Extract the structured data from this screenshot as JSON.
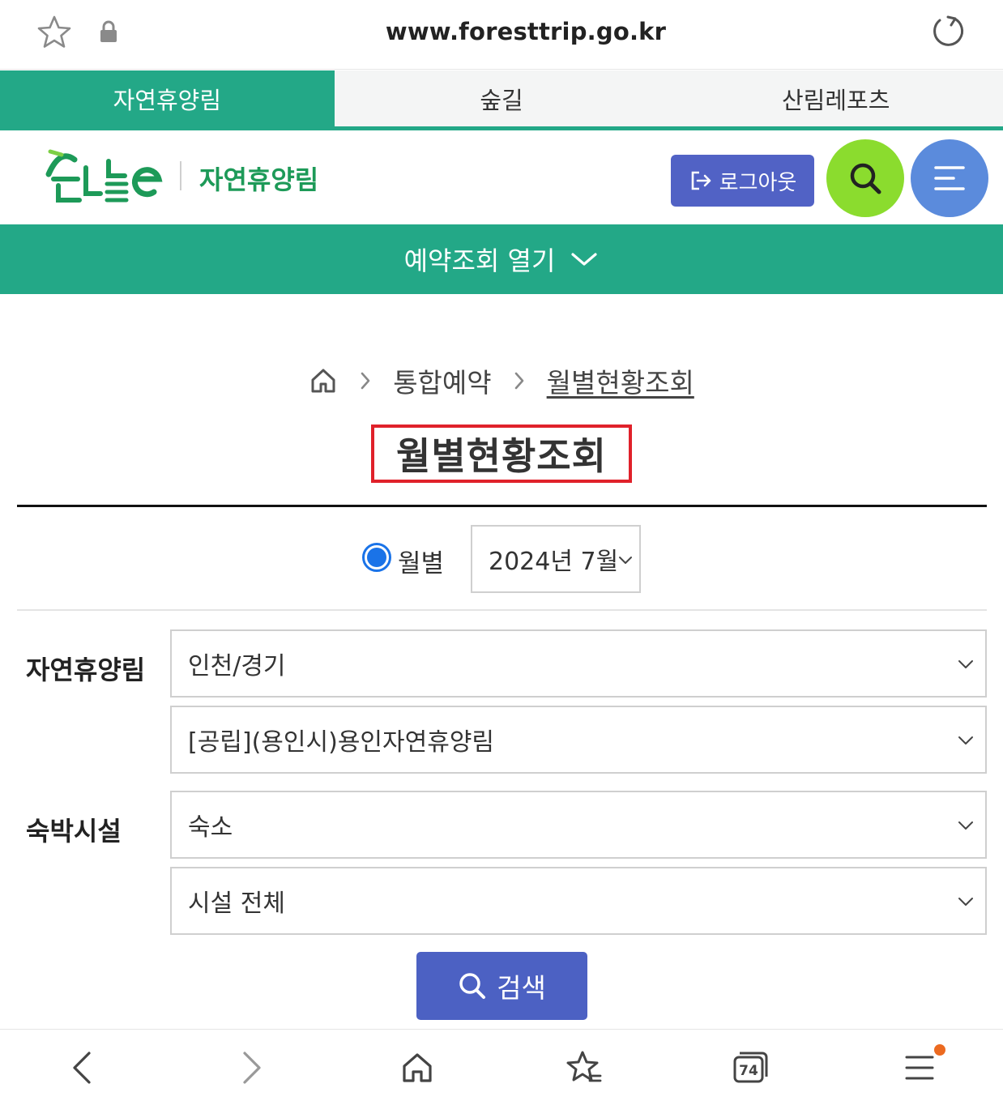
{
  "browser": {
    "url": "www.foresttrip.go.kr",
    "tab_count": "74"
  },
  "category_tabs": [
    {
      "label": "자연휴양림",
      "active": true
    },
    {
      "label": "숲길",
      "active": false
    },
    {
      "label": "산림레포츠",
      "active": false
    }
  ],
  "header": {
    "site_name": "자연휴양림",
    "logout_label": "로그아웃"
  },
  "reservation_bar": {
    "label": "예약조회 열기"
  },
  "breadcrumb": {
    "items": [
      "통합예약",
      "월별현황조회"
    ]
  },
  "page": {
    "title": "월별현황조회"
  },
  "month_filter": {
    "radio_label": "월별",
    "selected_month": "2024년 7월"
  },
  "form": {
    "forest_label": "자연휴양림",
    "region_value": "인천/경기",
    "forest_value": "[공립](용인시)용인자연휴양림",
    "facility_label": "숙박시설",
    "facility_type_value": "숙소",
    "facility_value": "시설 전체",
    "search_label": "검색"
  },
  "colors": {
    "brand_green": "#23a887",
    "logout_blue": "#5162c5",
    "search_green": "#8bdc2e",
    "menu_blue": "#5b8bdc",
    "highlight_red": "#e0212a",
    "search_button": "#4c61c3"
  },
  "icons": {
    "address_bar": [
      "bookmark-star-icon",
      "lock-icon",
      "reload-icon"
    ],
    "header": [
      "logo-icon",
      "logout-icon",
      "search-icon",
      "menu-icon"
    ],
    "bottom_nav": [
      "back-icon",
      "forward-icon",
      "home-icon",
      "bookmarks-icon",
      "tabs-icon",
      "menu-icon"
    ]
  }
}
